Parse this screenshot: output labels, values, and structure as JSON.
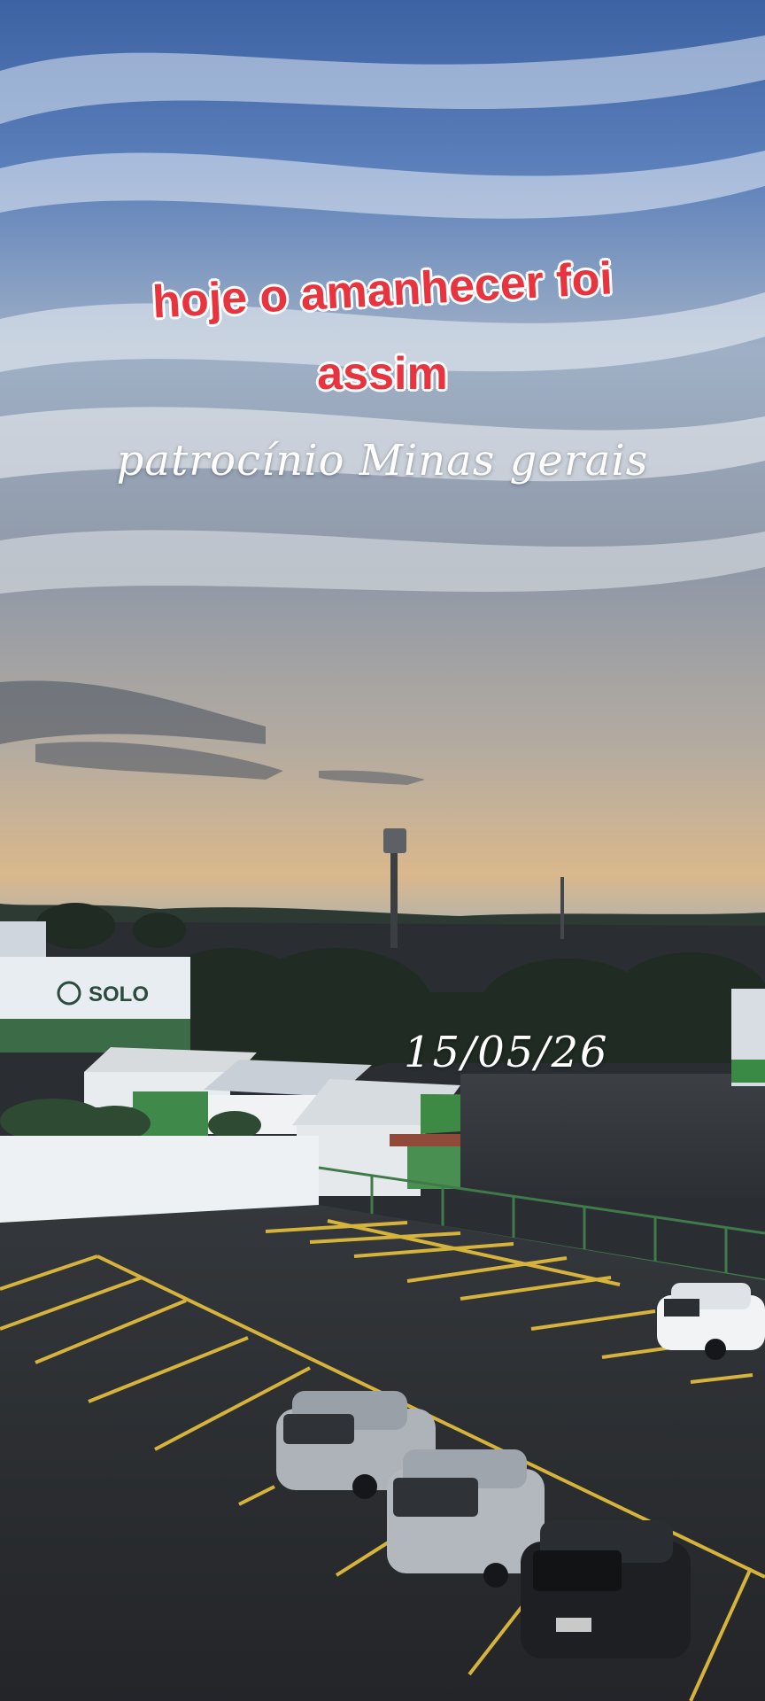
{
  "caption": {
    "line1": "hoje o amanhecer foi",
    "line2": "assim",
    "location": "patrocínio Minas gerais"
  },
  "date_stamp": "15/05/26",
  "scene": {
    "description_colors": {
      "sky_top": "#3f66a8",
      "sky_mid": "#9fb2c9",
      "horizon_glow": "#d9b27f",
      "pavement": "#2b2d30",
      "parking_lines": "#d9b640",
      "building_green": "#3a8a46"
    },
    "sign_text": "SOLO"
  }
}
